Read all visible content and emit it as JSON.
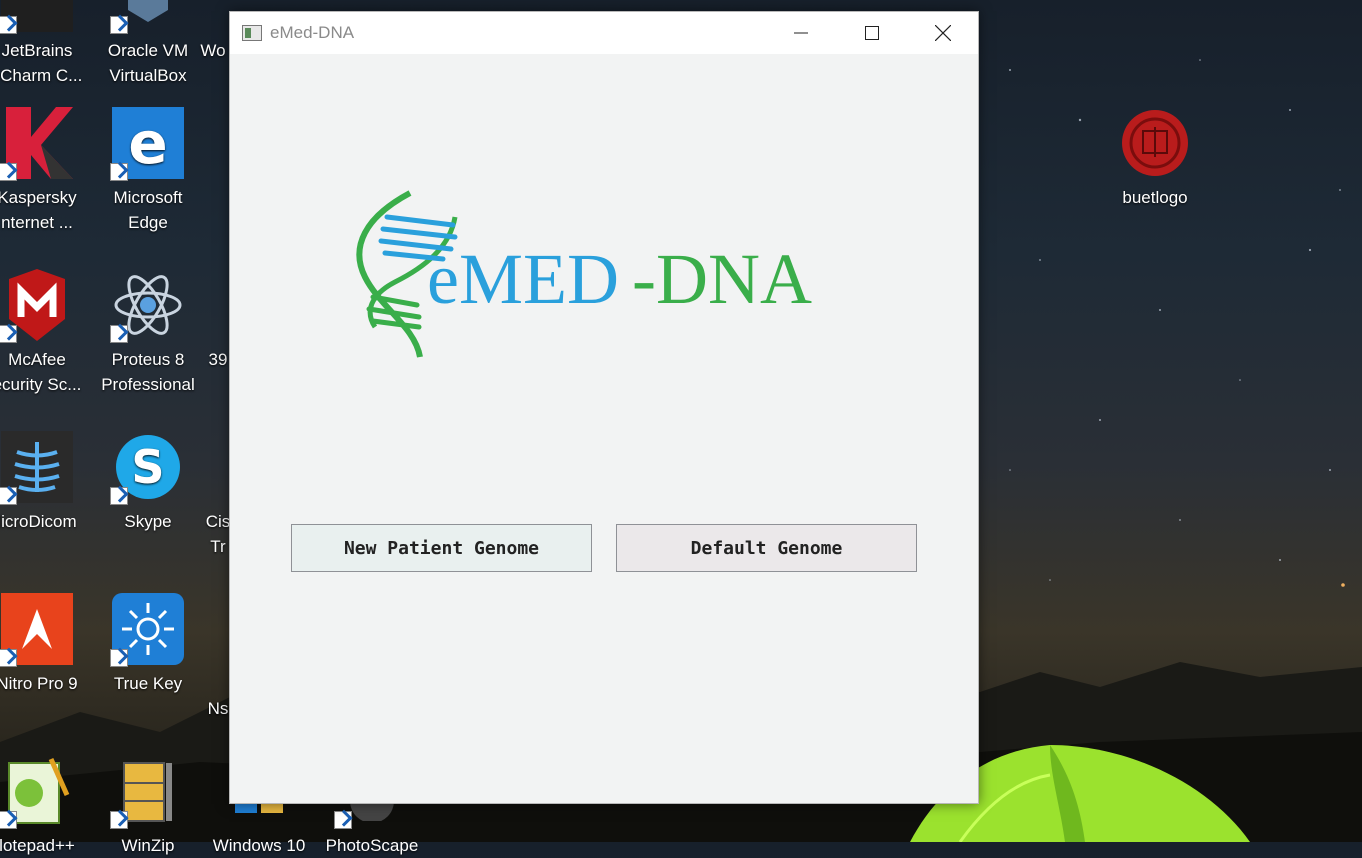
{
  "desktop": {
    "icons": [
      {
        "label": "JetBrains\nyCharm C..."
      },
      {
        "label": "Oracle VM\nVirtualBox"
      },
      {
        "label": "Wo"
      },
      {
        "label": "Kaspersky\nnternet ..."
      },
      {
        "label": "Microsoft\nEdge"
      },
      {
        "label": "McAfee\necurity Sc..."
      },
      {
        "label": "Proteus 8\nProfessional"
      },
      {
        "label": "39"
      },
      {
        "label": "licroDicom"
      },
      {
        "label": "Skype"
      },
      {
        "label": "Cis\nTr"
      },
      {
        "label": "Nitro Pro 9"
      },
      {
        "label": "True Key"
      },
      {
        "label": "Ns"
      },
      {
        "label": "buetlogo"
      },
      {
        "label": "lotepad++"
      },
      {
        "label": "WinZip"
      },
      {
        "label": "Windows 10"
      },
      {
        "label": "PhotoScape"
      }
    ]
  },
  "window": {
    "title": "eMed-DNA",
    "logo_text_e": "eMED",
    "logo_text_dash": "-DNA",
    "buttons": {
      "new_patient": "New Patient Genome",
      "default": "Default Genome"
    }
  },
  "colors": {
    "logo_blue": "#2aa0dc",
    "logo_green": "#3aae4a",
    "accent_red": "#b91c1c"
  }
}
